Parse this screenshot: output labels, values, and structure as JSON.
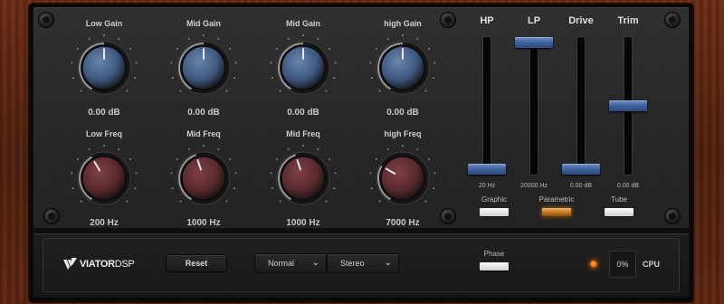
{
  "gain_knobs": [
    {
      "label": "Low Gain",
      "value": "0.00 dB"
    },
    {
      "label": "Mid Gain",
      "value": "0.00 dB"
    },
    {
      "label": "Mid Gain",
      "value": "0.00 dB"
    },
    {
      "label": "high Gain",
      "value": "0.00 dB"
    }
  ],
  "freq_knobs": [
    {
      "label": "Low Freq",
      "value": "200 Hz"
    },
    {
      "label": "Mid Freq",
      "value": "1000 Hz"
    },
    {
      "label": "Mid Freq",
      "value": "1000 Hz"
    },
    {
      "label": "high Freq",
      "value": "7000 Hz"
    }
  ],
  "sliders": [
    {
      "label": "HP",
      "value": "20 Hz",
      "level": 0.0
    },
    {
      "label": "LP",
      "value": "20000 Hz",
      "level": 1.0
    },
    {
      "label": "Drive",
      "value": "0.00 dB",
      "level": 0.0
    },
    {
      "label": "Trim",
      "value": "0.00 dB",
      "level": 0.5
    }
  ],
  "eq_modes": [
    {
      "label": "Graphic",
      "active": false
    },
    {
      "label": "Parametric",
      "active": true
    },
    {
      "label": "Tube",
      "active": false
    }
  ],
  "brand": {
    "bold": "VIATOR",
    "light": "DSP"
  },
  "bottom": {
    "reset_label": "Reset",
    "mode_select": "Normal",
    "channel_select": "Stereo",
    "phase_label": "Phase",
    "cpu_value": "0%",
    "cpu_label": "CPU"
  },
  "colors": {
    "gain_knob": "#3e5880",
    "freq_knob": "#5a2a2e",
    "slider_thumb": "#3b5d98",
    "active_toggle": "#c57b26",
    "wood": "#5c2410"
  }
}
